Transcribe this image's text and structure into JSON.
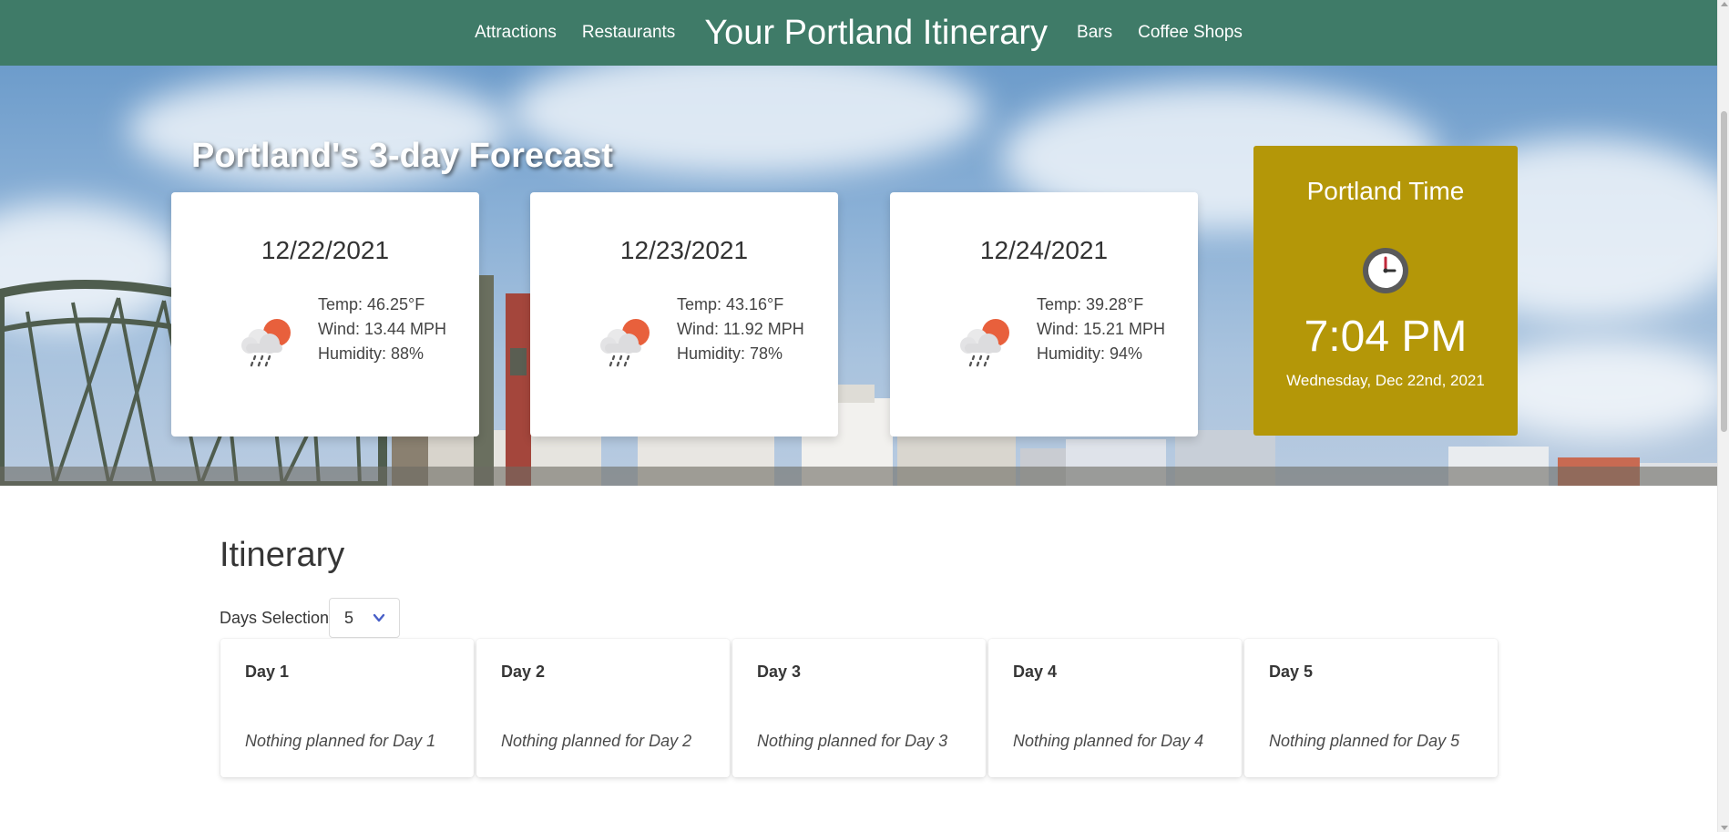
{
  "nav": {
    "links_left": [
      "Attractions",
      "Restaurants"
    ],
    "title": "Your Portland Itinerary",
    "links_right": [
      "Bars",
      "Coffee Shops"
    ]
  },
  "forecast": {
    "heading": "Portland's 3-day Forecast",
    "days": [
      {
        "date": "12/22/2021",
        "temp": "Temp: 46.25°F",
        "wind": "Wind: 13.44 MPH",
        "humidity": "Humidity: 88%",
        "icon": "rain-cloud-sun-icon"
      },
      {
        "date": "12/23/2021",
        "temp": "Temp: 43.16°F",
        "wind": "Wind: 11.92 MPH",
        "humidity": "Humidity: 78%",
        "icon": "rain-cloud-sun-icon"
      },
      {
        "date": "12/24/2021",
        "temp": "Temp: 39.28°F",
        "wind": "Wind: 15.21 MPH",
        "humidity": "Humidity: 94%",
        "icon": "rain-cloud-sun-icon"
      }
    ]
  },
  "time_card": {
    "title": "Portland Time",
    "time": "7:04 PM",
    "date": "Wednesday, Dec 22nd, 2021",
    "icon": "clock-icon",
    "background": "#b49708"
  },
  "itinerary": {
    "heading": "Itinerary",
    "days_label": "Days Selection:",
    "days_selected": "5",
    "days": [
      {
        "title": "Day 1",
        "empty_text": "Nothing planned for Day 1"
      },
      {
        "title": "Day 2",
        "empty_text": "Nothing planned for Day 2"
      },
      {
        "title": "Day 3",
        "empty_text": "Nothing planned for Day 3"
      },
      {
        "title": "Day 4",
        "empty_text": "Nothing planned for Day 4"
      },
      {
        "title": "Day 5",
        "empty_text": "Nothing planned for Day 5"
      }
    ]
  },
  "colors": {
    "navbar": "#3f7b68",
    "accent_chevron": "#485fc7"
  }
}
